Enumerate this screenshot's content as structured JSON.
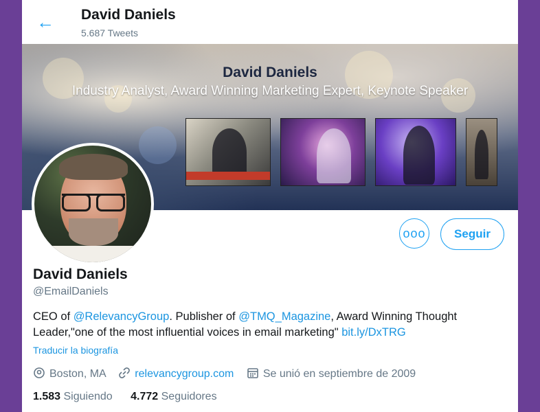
{
  "header": {
    "back_icon": "arrow-left-icon",
    "name": "David Daniels",
    "tweet_count": "5.687 Tweets"
  },
  "banner": {
    "title": "David Daniels",
    "subtitle": "Industry Analyst, Award Winning Marketing Expert, Keynote Speaker"
  },
  "actions": {
    "more_icon": "ooo",
    "follow_label": "Seguir"
  },
  "profile": {
    "name": "David Daniels",
    "handle": "@EmailDaniels",
    "bio": {
      "part1": "CEO of ",
      "mention1": "@RelevancyGroup",
      "part2": ". Publisher of ",
      "mention2": "@TMQ_Magazine",
      "part3": ", Award Winning Thought Leader,\"one of the most influential voices in email marketing\" ",
      "link": "bit.ly/DxTRG"
    },
    "translate": "Traducir la biografía",
    "location": "Boston, MA",
    "website": "relevancygroup.com",
    "joined": "Se unió en septiembre de 2009",
    "following_count": "1.583",
    "following_label": "Siguiendo",
    "followers_count": "4.772",
    "followers_label": "Seguidores"
  },
  "colors": {
    "accent": "#1da1f2",
    "page_background": "#6a3f96",
    "secondary_text": "#657786"
  }
}
